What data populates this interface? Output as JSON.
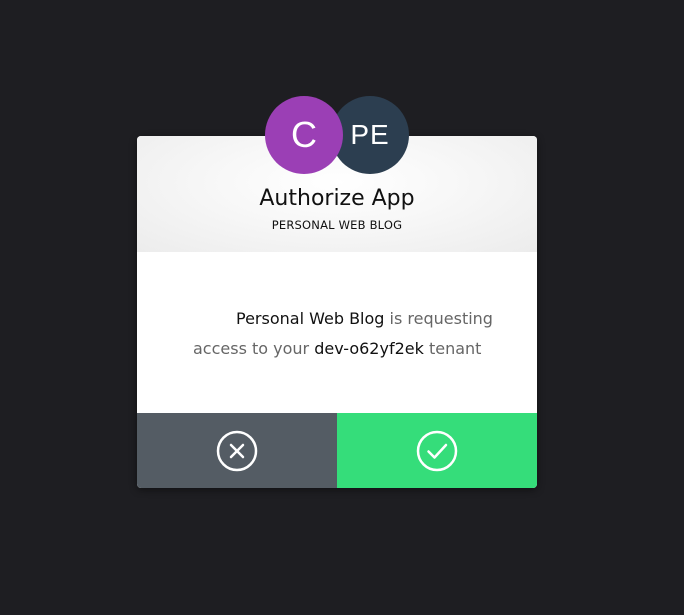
{
  "dialog": {
    "client_avatar": {
      "initials": "C",
      "color": "#9b3fb5"
    },
    "tenant_avatar": {
      "initials": "PE",
      "color": "#2c3e50"
    },
    "title": "Authorize App",
    "subtitle": "PERSONAL WEB BLOG",
    "message": {
      "app_name": "Personal Web Blog",
      "text_requesting": " is requesting",
      "text_access": "access to your ",
      "tenant_name": "dev-o62yf2ek",
      "text_tenant": " tenant"
    },
    "actions": {
      "deny": {
        "icon": "close-circle-icon",
        "color": "#545c64"
      },
      "accept": {
        "icon": "check-circle-icon",
        "color": "#35dd7a"
      }
    }
  }
}
